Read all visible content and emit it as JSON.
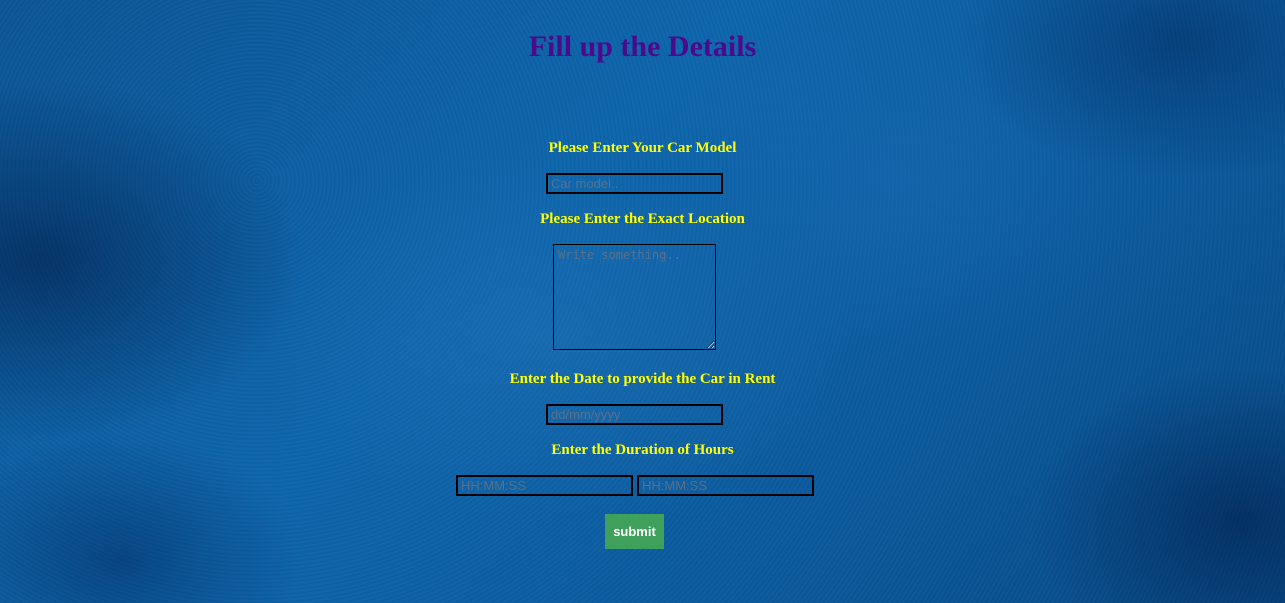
{
  "page": {
    "title": "Fill up the Details",
    "colors": {
      "title": "#4b0a8c",
      "labels": "#ffff00",
      "submit_background": "#3ea05a",
      "background": "#0a5a9c"
    }
  },
  "form": {
    "car_model": {
      "label": "Please Enter Your Car Model",
      "placeholder": "Car model..",
      "value": ""
    },
    "location": {
      "label": "Please Enter the Exact Location",
      "placeholder": "Write something..",
      "value": ""
    },
    "date": {
      "label": "Enter the Date to provide the Car in Rent",
      "placeholder": "dd/mm/yyyy",
      "value": ""
    },
    "duration": {
      "label": "Enter the Duration of Hours",
      "start_placeholder": "HH:MM:SS",
      "end_placeholder": "HH:MM:SS"
    },
    "submit_label": "submit"
  }
}
